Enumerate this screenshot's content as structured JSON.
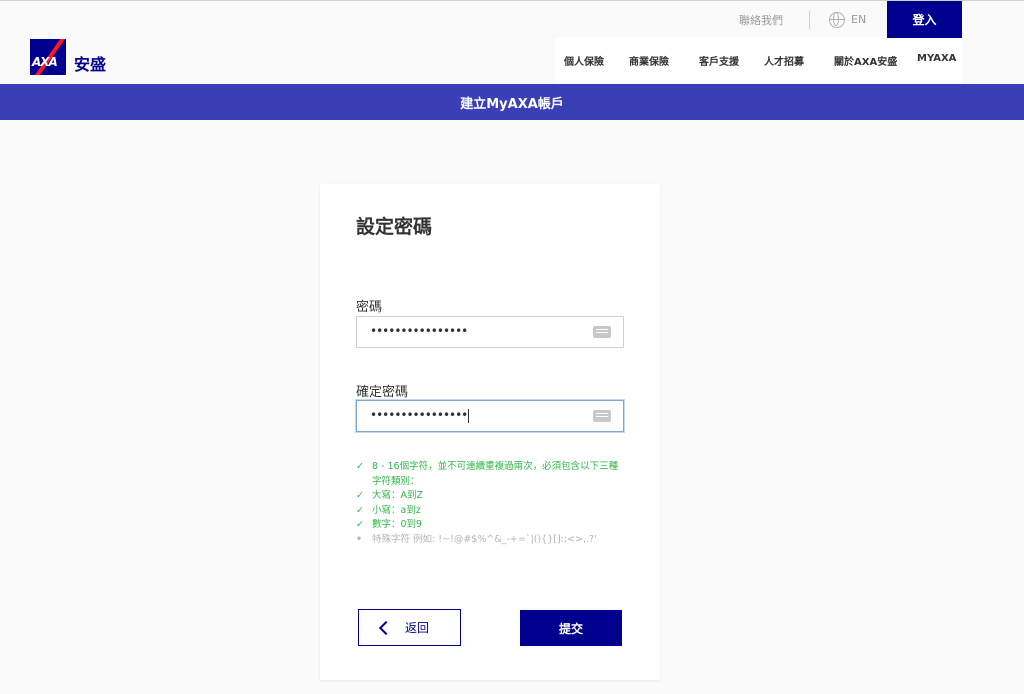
{
  "brand": {
    "logo_text": "AXA",
    "name": "安盛"
  },
  "utility": {
    "contact": "聯絡我們",
    "language": "EN",
    "login": "登入"
  },
  "nav": {
    "items": [
      "個人保險",
      "商業保險",
      "客戶支援",
      "人才招募",
      "關於AXA安盛",
      "MYAXA"
    ]
  },
  "banner": {
    "title": "建立MyAXA帳戶"
  },
  "form": {
    "title": "設定密碼",
    "password_label": "密碼",
    "password_value": "••••••••••••••••",
    "confirm_label": "確定密碼",
    "confirm_value": "••••••••••••••••"
  },
  "rules": [
    {
      "status": "ok",
      "mark": "✓",
      "text": "8 - 16個字符，並不可連續重複過兩次，必須包含以下三種字符類別："
    },
    {
      "status": "ok",
      "mark": "✓",
      "text": "大寫：A到Z"
    },
    {
      "status": "ok",
      "mark": "✓",
      "text": "小寫：a到z"
    },
    {
      "status": "ok",
      "mark": "✓",
      "text": "數字：0到9"
    },
    {
      "status": "pending",
      "mark": "•",
      "text": "特殊字符 例如: !~!@#$%^&_-+=`|(){}[]:;<>,.?'"
    }
  ],
  "buttons": {
    "back": "返回",
    "submit": "提交"
  },
  "colors": {
    "brand_blue": "#00008f",
    "banner": "#3b3fb6",
    "success": "#2fb54a",
    "brand_red": "#ff1721"
  }
}
